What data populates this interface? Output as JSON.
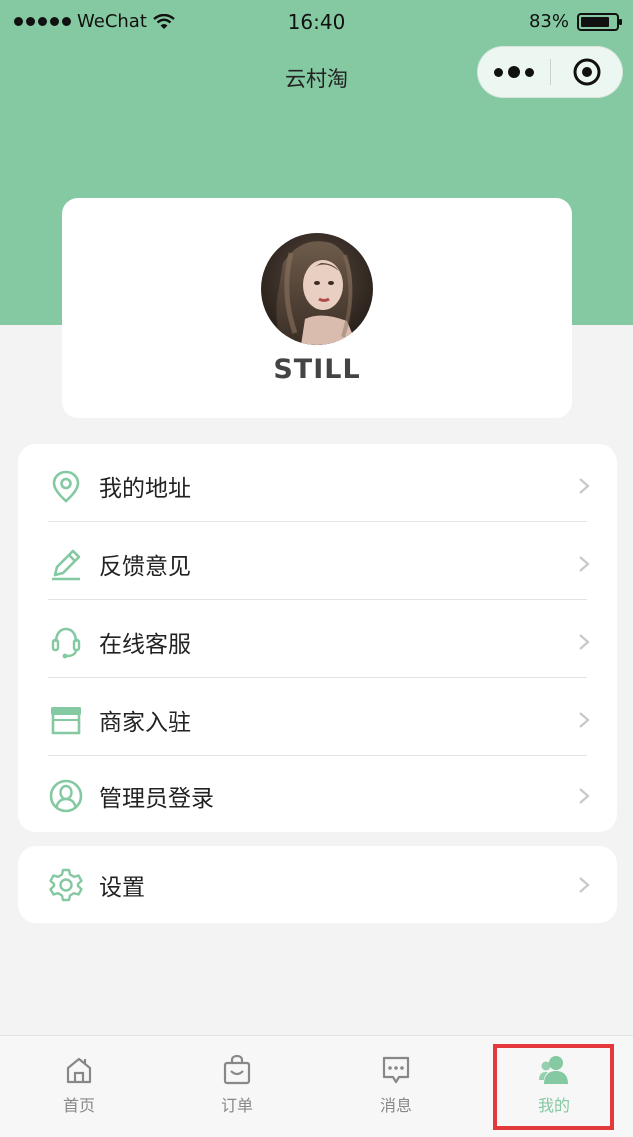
{
  "status_bar": {
    "carrier": "WeChat",
    "time": "16:40",
    "battery_percent": "83%",
    "battery_level": 0.83
  },
  "nav": {
    "title": "云村淘"
  },
  "profile": {
    "username": "STILL"
  },
  "menu": {
    "items": [
      {
        "label": "我的地址",
        "icon": "location-pin-icon"
      },
      {
        "label": "反馈意见",
        "icon": "pencil-icon"
      },
      {
        "label": "在线客服",
        "icon": "headset-icon"
      },
      {
        "label": "商家入驻",
        "icon": "storefront-icon"
      },
      {
        "label": "管理员登录",
        "icon": "user-circle-icon"
      }
    ],
    "settings": {
      "label": "设置",
      "icon": "gear-icon"
    }
  },
  "tabs": [
    {
      "label": "首页",
      "icon": "home-icon"
    },
    {
      "label": "订单",
      "icon": "shopping-bag-icon"
    },
    {
      "label": "消息",
      "icon": "message-icon"
    },
    {
      "label": "我的",
      "icon": "person-icon"
    }
  ],
  "colors": {
    "accent": "#84c9a1",
    "highlight": "#e5383b",
    "background": "#f3f3f3"
  }
}
